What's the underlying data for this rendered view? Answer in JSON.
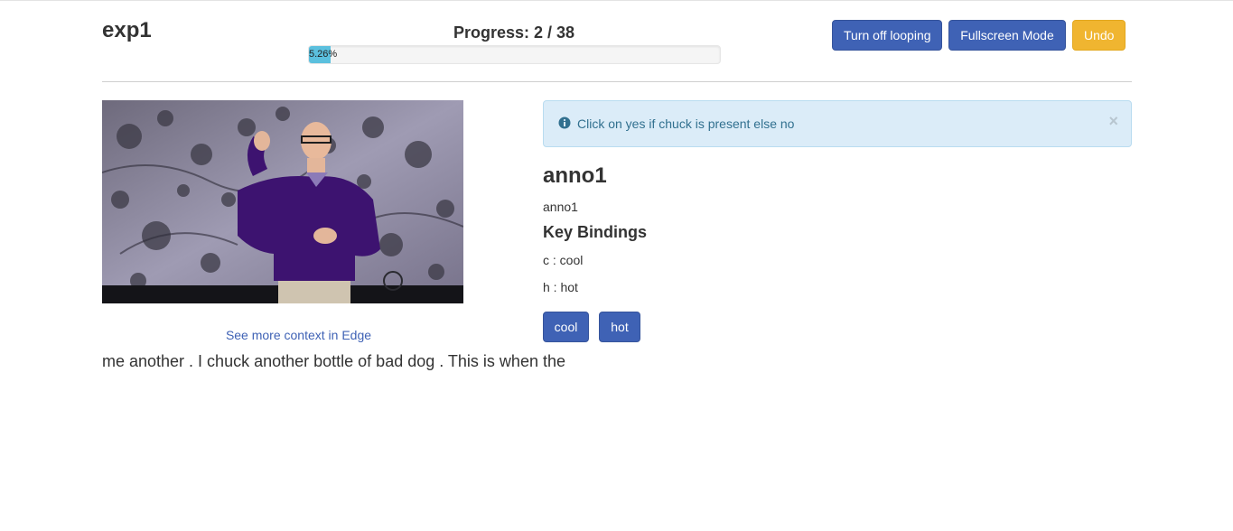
{
  "header": {
    "title": "exp1",
    "progress": {
      "label": "Progress: 2 / 38",
      "percent_text": "5.26%",
      "fraction": 0.0526
    },
    "buttons": {
      "looping": "Turn off looping",
      "fullscreen": "Fullscreen Mode",
      "undo": "Undo"
    }
  },
  "media": {
    "context_link": "See more context in Edge",
    "transcript": "me another . I chuck another bottle of bad dog . This is when the"
  },
  "alert": {
    "icon": "info-circle-icon",
    "text": "Click on yes if chuck is present else no",
    "close": "×"
  },
  "annotation": {
    "title": "anno1",
    "subtitle": "anno1",
    "key_bindings_title": "Key Bindings",
    "bindings": [
      "c : cool",
      "h : hot"
    ],
    "buttons": {
      "cool": "cool",
      "hot": "hot"
    }
  },
  "colors": {
    "primary": "#3f62b5",
    "warning": "#f0b530",
    "progress": "#5bc0de",
    "alert_bg": "#dbecf8",
    "alert_text": "#31708f"
  }
}
